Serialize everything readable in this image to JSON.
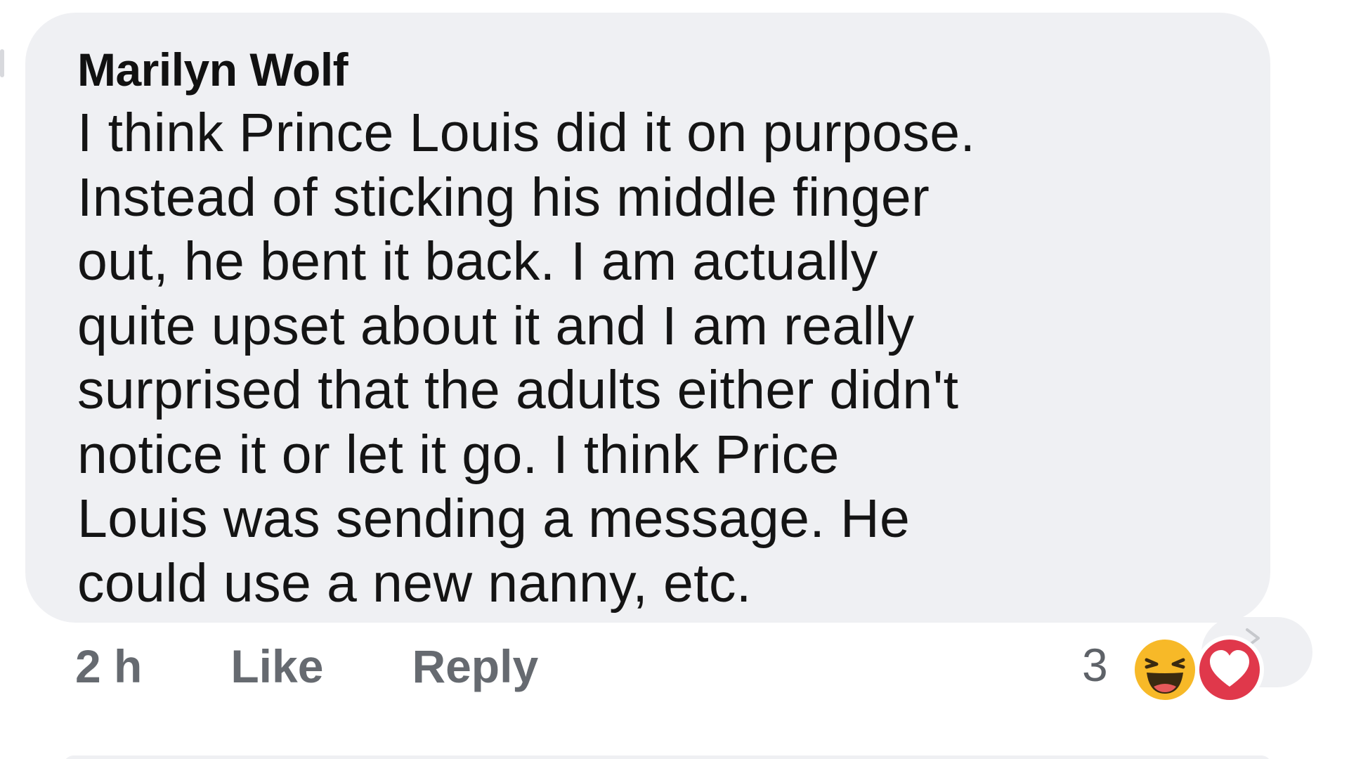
{
  "comment": {
    "author": "Marilyn Wolf",
    "lines": [
      "I think Prince Louis did it on purpose.",
      "Instead of sticking his middle finger",
      "out, he bent it back. I am actually",
      "quite upset about it and I am really",
      "surprised that the adults either didn't",
      "notice it or let it go. I think Price",
      "Louis was sending a message. He",
      "could use a new nanny, etc."
    ]
  },
  "actions": {
    "time": "2 h",
    "like_label": "Like",
    "reply_label": "Reply"
  },
  "reactions": {
    "count": "3",
    "icons": [
      "haha-emoji-icon",
      "love-heart-icon"
    ],
    "colors": {
      "haha": "#f7b928",
      "love": "#e0384b"
    }
  }
}
